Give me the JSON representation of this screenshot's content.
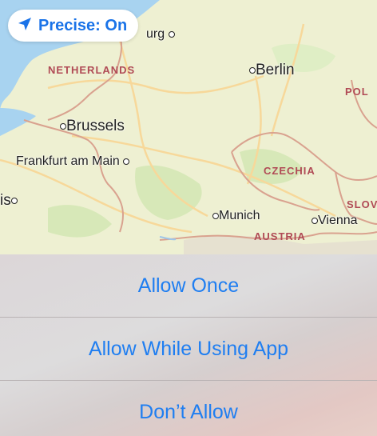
{
  "precise_toggle": {
    "label": "Precise: On",
    "icon": "location-arrow-icon"
  },
  "map": {
    "cities": {
      "burg": "urg",
      "berlin": "Berlin",
      "brussels": "Brussels",
      "frankfurt": "Frankfurt am Main",
      "paris": "is",
      "munich": "Munich",
      "vienna": "Vienna"
    },
    "countries": {
      "netherlands": "NETHERLANDS",
      "poland": "POL",
      "czechia": "CZECHIA",
      "slovakia": "SLOV",
      "austria": "AUSTRIA"
    }
  },
  "actions": {
    "allow_once": "Allow Once",
    "allow_while_using": "Allow While Using App",
    "dont_allow": "Don’t Allow"
  },
  "colors": {
    "accent": "#1f7ef1",
    "land": "#eef0d2",
    "water": "#a8d3f0",
    "border": "#d9a28f"
  }
}
